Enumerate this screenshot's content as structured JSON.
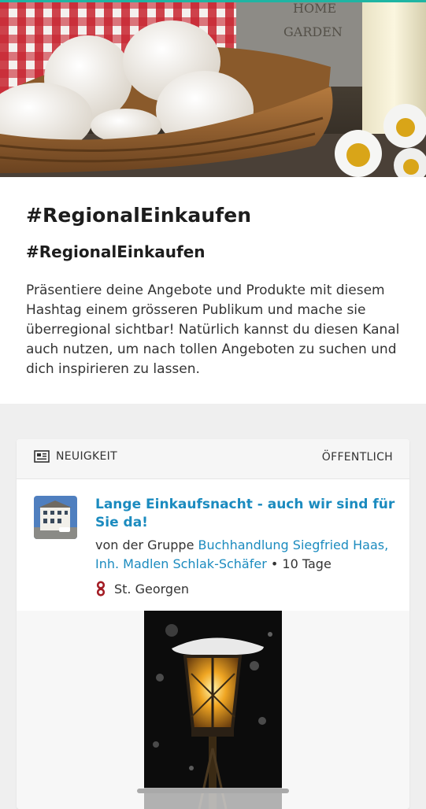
{
  "hero": {
    "image_alt": "eggs-in-basket-photo"
  },
  "intro": {
    "title": "#RegionalEinkaufen",
    "subtitle": "#RegionalEinkaufen",
    "description": "Präsentiere deine Angebote und Produkte mit diesem Hashtag einem grösseren Publikum und mache sie überregional sichtbar! Natürlich kannst du diesen Kanal auch nutzen, um nach tollen Angeboten zu suchen und dich inspirieren zu lassen."
  },
  "post": {
    "type_icon": "newspaper-icon",
    "type_label": "NEUIGKEIT",
    "visibility": "ÖFFENTLICH",
    "title": "Lange Einkaufsnacht - auch wir sind für Sie da!",
    "byline_prefix": "von der Gruppe ",
    "group_name": "Buchhandlung Siegfried Haas, Inh. Madlen Schlak-Schäfer",
    "separator": " • ",
    "age": "10 Tage",
    "location_icon": "location-pin-icon",
    "location": "St. Georgen"
  },
  "colors": {
    "accent": "#1fb5a3",
    "link": "#1b8bbf",
    "pin": "#a31c24"
  }
}
